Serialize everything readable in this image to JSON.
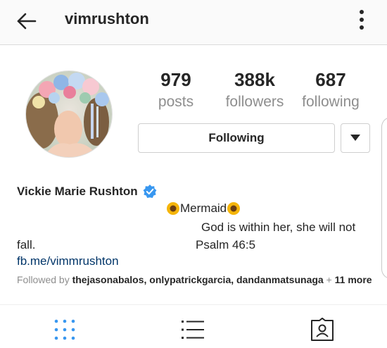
{
  "header": {
    "username": "vimrushton",
    "back_icon": "arrow-left-icon",
    "more_icon": "vertical-dots-icon"
  },
  "profile": {
    "stats": {
      "posts_count": "979",
      "posts_label": "posts",
      "followers_count": "388k",
      "followers_label": "followers",
      "following_count": "687",
      "following_label": "following"
    },
    "follow_button_label": "Following",
    "full_name": "Vickie Marie Rushton",
    "verified": true,
    "bio": {
      "line1": "Mermaid",
      "line2": "God is within her, she will not",
      "line3a": "fall.",
      "line3b": "Psalm 46:5"
    },
    "link": "fb.me/vimmrushton",
    "followed_by": {
      "prefix": "Followed by",
      "names": "thejasonabalos, onlypatrickgarcia, dandanmatsunaga",
      "suffix_sep": "+",
      "more": "11 more"
    }
  },
  "colors": {
    "accent_blue": "#3897f0",
    "link_blue": "#003569",
    "text_dark": "#262626",
    "text_muted": "#8e8e8e",
    "sunflower": "#f5b50a"
  },
  "tabs": [
    "grid-icon",
    "list-icon",
    "tagged-icon"
  ]
}
